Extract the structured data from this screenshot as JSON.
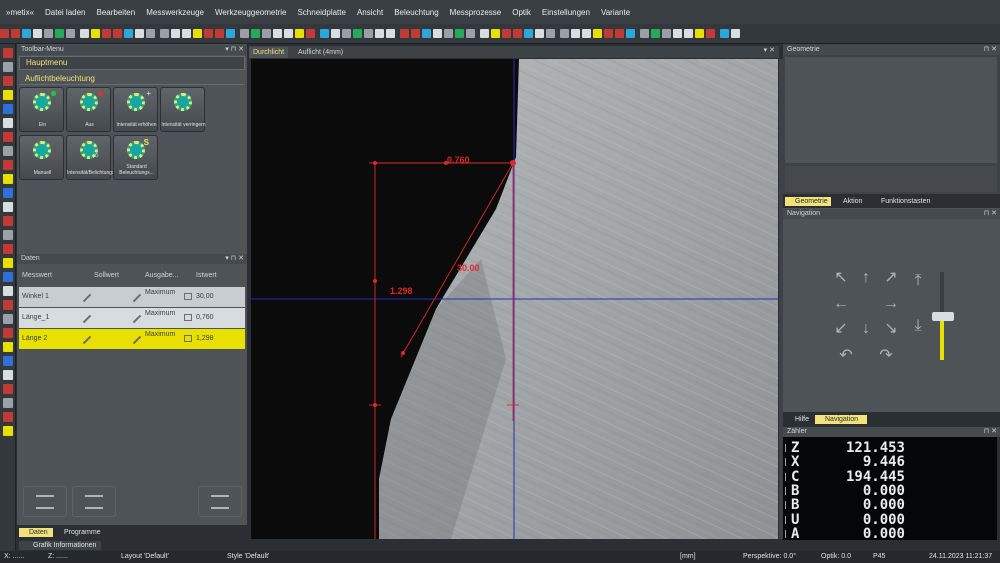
{
  "menu": {
    "items": [
      "»metix«",
      "Datei laden",
      "Bearbeiten",
      "Messwerkzeuge",
      "Werkzeuggeometrie",
      "Schneidplatte",
      "Ansicht",
      "Beleuchtung",
      "Messprozesse",
      "Optik",
      "Einstellungen",
      "Variante"
    ]
  },
  "toolbar_menu": {
    "title": "Toolbar-Menu",
    "hauptmenu": "Hauptmenu",
    "section": "Auflichtbeleuchtung",
    "buttons": [
      {
        "label": "Ein",
        "badge": "#27c43f"
      },
      {
        "label": "Aus",
        "badge": "#e0332e"
      },
      {
        "label": "Intensität erhöhen",
        "badge": "#d8dde1"
      },
      {
        "label": "Intensität verringern",
        "badge": ""
      },
      {
        "label": "Manuell",
        "badge": ""
      },
      {
        "label": "Intensität/Belichtungszeit/Ver...",
        "badge": ""
      },
      {
        "label": "Standard Beleuchtungs...",
        "badge": "S"
      }
    ]
  },
  "daten": {
    "title": "Daten",
    "columns": [
      "Messwert",
      "Sollwert",
      "Ausgabe...",
      "Istwert"
    ],
    "rows": [
      {
        "name": "Winkel 1",
        "ausgabe": "Maximum",
        "ist": "30,00"
      },
      {
        "name": "Länge_1",
        "ausgabe": "Maximum",
        "ist": "0,760"
      },
      {
        "name": "Länge 2",
        "ausgabe": "Maximum",
        "ist": "1,298"
      }
    ],
    "tabs": [
      "Daten",
      "Programme"
    ],
    "bottom_tab": "Grafik Informationen"
  },
  "view": {
    "tabs": [
      "Durchlicht",
      "Auflicht (4mm)"
    ],
    "annotations": {
      "top_length": "0.760",
      "angle": "30.00",
      "side_length": "1.298"
    }
  },
  "right": {
    "geometrie_title": "Geometrie",
    "tabs": [
      "Geometrie",
      "Aktion",
      "Funktionstasten"
    ],
    "navigation_title": "Navigation",
    "bottom_tabs": [
      "Hilfe",
      "Navigation"
    ],
    "zaehler_title": "Zähler",
    "counter": [
      {
        "axis": "Z",
        "value": "121.453",
        "color": "#e8eaec"
      },
      {
        "axis": "X",
        "value": "9.446",
        "color": "#e8eaec"
      },
      {
        "axis": "C",
        "value": "194.445",
        "color": "#e8eaec"
      },
      {
        "axis": "B",
        "value": "0.000",
        "color": "#e8eaec"
      },
      {
        "axis": "B",
        "value": "0.000",
        "color": "#e8eaec"
      },
      {
        "axis": "U",
        "value": "0.000",
        "color": "#e8eaec"
      },
      {
        "axis": "A",
        "value": "0.000",
        "color": "#e8eaec"
      }
    ]
  },
  "status": {
    "x": "X: ......",
    "z": "Z: ......",
    "layout": "Layout 'Default'",
    "style": "Style 'Default'",
    "unit": "[mm]",
    "perspektive": "Perspektive: 0.0°",
    "optik": "Optik: 0.0",
    "p": "P45",
    "datetime": "24.11.2023 11:21:37"
  },
  "colors": {
    "accent_yellow": "#e8e000",
    "measure_red": "#e0282a",
    "crosshair_blue": "#2a2ab8",
    "counter_text": "#e8eaec"
  }
}
